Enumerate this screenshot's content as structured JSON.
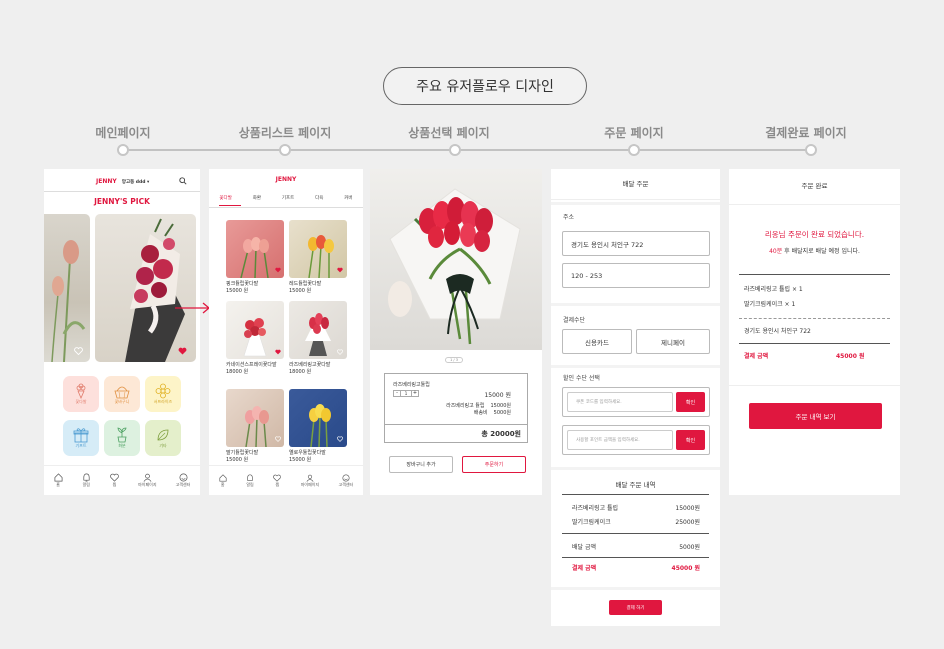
{
  "title": "주요 유저플로우 디자인",
  "steps": [
    "메인페이지",
    "상품리스트 페이지",
    "상품선택 페이지",
    "주문 페이지",
    "결제완료 페이지"
  ],
  "colors": {
    "accent": "#e0173f",
    "background": "#efefef"
  },
  "main": {
    "brand": "JENNY",
    "location": "망고동 ddd ▾",
    "pick_title": "JENNY'S PICK",
    "categories": [
      "꽃다발",
      "꽃바구니",
      "서프라이즈",
      "기프트",
      "화분",
      "기타"
    ],
    "tabs": [
      "홈",
      "알림",
      "찜",
      "마이페이지",
      "고객센터"
    ]
  },
  "list": {
    "brand": "JENNY",
    "tabs": [
      "꽃다발",
      "화환",
      "기프트",
      "다육",
      "커버"
    ],
    "products": [
      {
        "name": "핑크튤립꽃다발",
        "price": "15000 원"
      },
      {
        "name": "레드튤립꽃다발",
        "price": "15000 원"
      },
      {
        "name": "카네이션스프레이꽃다발",
        "price": "18000 원"
      },
      {
        "name": "라즈베리링고꽃다발",
        "price": "18000 원"
      },
      {
        "name": "딸기튤립꽃다발",
        "price": "15000 원"
      },
      {
        "name": "옐로우튤립꽃다발",
        "price": "15000 원"
      }
    ],
    "tabbar": [
      "홈",
      "알림",
      "찜",
      "마이페이지",
      "고객센터"
    ]
  },
  "detail": {
    "dots": "1 / 3",
    "product_name": "라즈베리링고튤립",
    "qty": "1",
    "price": "15000 원",
    "option_line": "라즈베리링고 튤립",
    "option_price": "15000원",
    "ship_label": "배송비",
    "ship_price": "5000원",
    "total": "총 20000원",
    "cart_btn": "장바구니 추가",
    "order_btn": "주문하기"
  },
  "order": {
    "header": "배달 주문",
    "address_label": "주소",
    "address": "경기도 용인시 처인구 722",
    "address_detail": "120 - 253",
    "payment_label": "결제수단",
    "pay_options": [
      "신용카드",
      "제니페이"
    ],
    "discount_label": "할인 수단 선택",
    "coupon_placeholder": "쿠폰 코드를 입력하세요.",
    "point_placeholder": "사용할 포인트 금액을 입력하세요.",
    "confirm": "확인",
    "summary_title": "배달 주문 내역",
    "items": [
      {
        "name": "라즈베리링고 튤립",
        "price": "15000원"
      },
      {
        "name": "딸기크림케이크",
        "price": "25000원"
      }
    ],
    "ship_label": "배달 금액",
    "ship_price": "5000원",
    "total_label": "결제 금액",
    "total_price": "45000 원",
    "pay_btn": "결제 하기"
  },
  "complete": {
    "header": "주문 완료",
    "message": "리옹님 주문이 완료 되었습니다.",
    "eta_num": "40분",
    "eta_text": " 후 배달지로 배달 예정 입니다.",
    "items": [
      "라즈베리링고 튤립 × 1",
      "딸기크림케이크 × 1"
    ],
    "address": "경기도 용인시 처인구 722",
    "total_label": "결제 금액",
    "total_price": "45000 원",
    "button": "주문 내역 보기"
  }
}
